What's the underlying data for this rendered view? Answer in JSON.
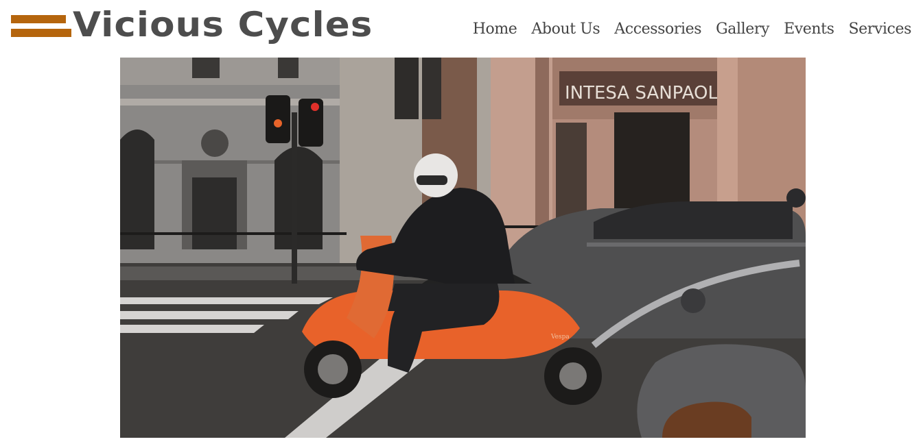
{
  "header": {
    "brand": "Vicious Cycles",
    "nav": [
      {
        "label": "Home"
      },
      {
        "label": "About Us"
      },
      {
        "label": "Accessories"
      },
      {
        "label": "Gallery"
      },
      {
        "label": "Events"
      },
      {
        "label": "Services"
      }
    ]
  },
  "colors": {
    "brand_accent": "#b5650d",
    "brand_text": "#4d4d4d",
    "nav_text": "#444444",
    "scooter": "#e8622a"
  },
  "hero": {
    "sign_text": "INTESA SANPAOLO",
    "scooter_badge": "Vespa"
  }
}
